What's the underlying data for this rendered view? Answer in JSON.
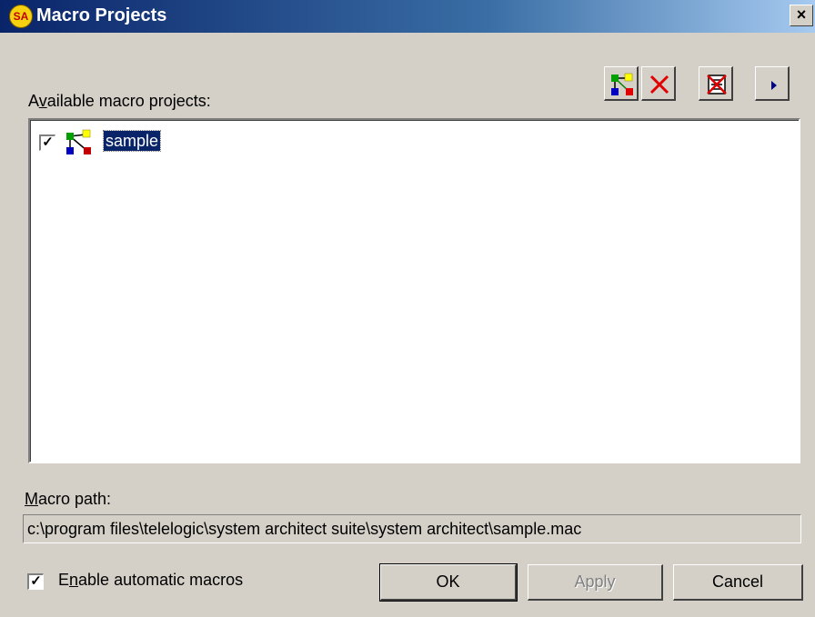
{
  "window": {
    "title": "Macro Projects",
    "app_badge": "SA",
    "close_glyph": "×"
  },
  "toolbar": {
    "buttons": [
      {
        "icon": "add-project-icon",
        "tooltip": ""
      },
      {
        "icon": "delete-icon"
      },
      {
        "icon": "remove-all-icon"
      },
      {
        "icon": "run-icon"
      }
    ]
  },
  "projects": {
    "label_prefix": "A",
    "label_mnemonic": "v",
    "label_rest": "ailable macro projects:",
    "items": [
      {
        "name": "sample",
        "checked": true,
        "selected": true
      }
    ]
  },
  "macro_path": {
    "label_mnemonic": "M",
    "label_rest": "acro path:",
    "value": "c:\\program files\\telelogic\\system architect suite\\system architect\\sample.mac"
  },
  "auto_macros": {
    "label_first": "E",
    "label_mnemonic": "n",
    "label_rest": "able automatic macros",
    "checked": true
  },
  "buttons": {
    "ok": "OK",
    "apply": "Apply",
    "cancel": "Cancel"
  },
  "colors": {
    "title_gradient_start": "#0a246a",
    "title_gradient_end": "#a6caf0",
    "selection": "#0a246a",
    "face": "#d4d0c8"
  }
}
